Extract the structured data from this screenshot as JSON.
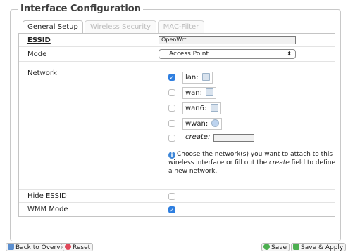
{
  "section": {
    "title": "Interface Configuration"
  },
  "tabs": [
    {
      "label": "General Setup",
      "active": true
    },
    {
      "label": "Wireless Security",
      "active": false
    },
    {
      "label": "MAC-Filter",
      "active": false
    }
  ],
  "essid": {
    "label": "ESSID",
    "value": "OpenWrt"
  },
  "mode": {
    "label": "Mode",
    "value": "Access Point",
    "arrow": "⬍"
  },
  "network": {
    "label": "Network",
    "items": [
      {
        "name": "lan:",
        "checked": true,
        "icon": "ethernet-icon"
      },
      {
        "name": "wan:",
        "checked": false,
        "icon": "ethernet-icon"
      },
      {
        "name": "wan6:",
        "checked": false,
        "icon": "ethernet-icon"
      },
      {
        "name": "wwan:",
        "checked": false,
        "icon": "wireless-icon"
      }
    ],
    "create_label": "create:",
    "create_value": "",
    "help_before": "Choose the network(s) you want to attach to this wireless interface or fill out the ",
    "help_em": "create",
    "help_after": " field to define a new network."
  },
  "hide_essid": {
    "label_prefix": "Hide ",
    "label_underlined": "ESSID",
    "checked": false
  },
  "wmm": {
    "label": "WMM Mode",
    "checked": true
  },
  "footer": {
    "back": "Back to Overview",
    "reset": "Reset",
    "save": "Save",
    "save_apply": "Save & Apply"
  },
  "colors": {
    "accent": "#2f7fe0",
    "reset_icon": "#e0485a",
    "save_icon": "#4caf50"
  }
}
